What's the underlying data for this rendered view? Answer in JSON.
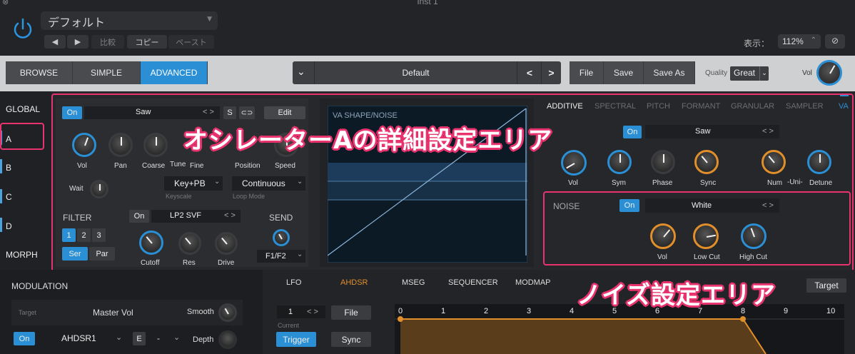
{
  "header": {
    "title": "Inst 1",
    "preset": "デフォルト",
    "buttons": [
      "◀",
      "▶",
      "比較",
      "コピー",
      "ペースト"
    ],
    "display_label": "表示：",
    "zoom": "112%",
    "zoom_arrows": "⌃",
    "link_icon": "⊘"
  },
  "toolbar": {
    "tabs": [
      "BROWSE",
      "SIMPLE",
      "ADVANCED"
    ],
    "preset_name": "Default",
    "preset_dropdown": "⌄",
    "prev": "<",
    "next": ">",
    "file": "File",
    "save": "Save",
    "save_as": "Save As",
    "quality_label": "Quality",
    "quality_value": "Great",
    "vol_label": "Vol"
  },
  "sidebar": {
    "items": [
      "GLOBAL",
      "A",
      "B",
      "C",
      "D",
      "MORPH"
    ]
  },
  "osc": {
    "on": "On",
    "wave": "Saw",
    "arrows": "< >",
    "s": "S",
    "link": "⊂⊃",
    "edit": "Edit",
    "knobs": [
      "Vol",
      "Pan",
      "Coarse",
      "Tune",
      "Fine",
      "Position",
      "Speed"
    ],
    "wait": "Wait",
    "keypb": "Key+PB",
    "keyscale": "Keyscale",
    "continuous": "Continuous",
    "loopmode": "Loop Mode",
    "filter": "FILTER",
    "filter_on": "On",
    "filter_type": "LP2 SVF",
    "filter_nums": [
      "1",
      "2",
      "3"
    ],
    "ser": "Ser",
    "par": "Par",
    "filter_knobs": [
      "Cutoff",
      "Res",
      "Drive"
    ],
    "send": "SEND",
    "send_value": "F1/F2"
  },
  "display": {
    "label": "VA SHAPE/NOISE"
  },
  "right": {
    "tabs": [
      "ADDITIVE",
      "SPECTRAL",
      "PITCH",
      "FORMANT",
      "GRANULAR",
      "SAMPLER",
      "VA"
    ],
    "va_on": "On",
    "va_wave": "Saw",
    "arrows": "< >",
    "knobs": [
      "Vol",
      "Sym",
      "Phase",
      "Sync",
      "Num",
      "-Uni-",
      "Detune"
    ],
    "noise_label": "NOISE",
    "noise_on": "On",
    "noise_type": "White",
    "noise_knobs": [
      "Vol",
      "Low Cut",
      "High Cut"
    ]
  },
  "annotations": {
    "osc": "オシレーターAの詳細設定エリア",
    "noise": "ノイズ設定エリア"
  },
  "modulation": {
    "title": "MODULATION",
    "target_lbl": "Target",
    "target": "Master Vol",
    "smooth": "Smooth",
    "on": "On",
    "source": "AHDSR1",
    "e": "E",
    "dash": "-",
    "depth": "Depth",
    "tabs": [
      "LFO",
      "AHDSR",
      "MSEG",
      "SEQUENCER",
      "MODMAP"
    ],
    "target_btn": "Target",
    "num": "1",
    "current": "Current",
    "file": "File",
    "trigger": "Trigger",
    "sync": "Sync",
    "ruler": [
      "0",
      "1",
      "2",
      "3",
      "4",
      "5",
      "6",
      "7",
      "8",
      "9",
      "10"
    ]
  }
}
